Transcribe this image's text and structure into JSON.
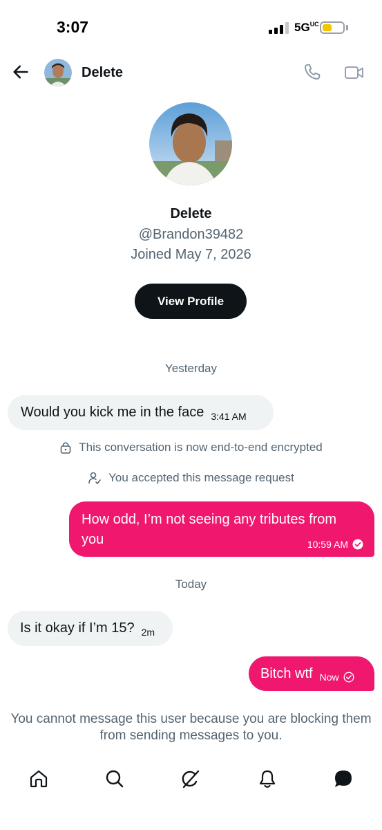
{
  "status_bar": {
    "time": "3:07",
    "network": "5G",
    "network_suffix": "UC",
    "battery_fill_fraction": 0.45,
    "battery_color": "#f5c400"
  },
  "header": {
    "title": "Delete"
  },
  "profile": {
    "name": "Delete",
    "handle": "@Brandon39482",
    "joined": "Joined May 7, 2026",
    "view_profile_label": "View Profile"
  },
  "conversation": {
    "date_yesterday": "Yesterday",
    "date_today": "Today",
    "messages": [
      {
        "direction": "incoming",
        "text": "Would you kick me in the face",
        "time": "3:41 AM"
      },
      {
        "direction": "outgoing",
        "text": "How odd, I’m not seeing any tributes from you",
        "time": "10:59 AM"
      },
      {
        "direction": "incoming",
        "text": "Is it okay if I’m 15?",
        "time": "2m"
      },
      {
        "direction": "outgoing",
        "text": "Bitch wtf",
        "time": "Now"
      }
    ],
    "system": {
      "encrypted": "This conversation is now end-to-end encrypted",
      "accepted": "You accepted this message request"
    },
    "blocked_notice": "You cannot message this user because you are blocking them from sending messages to you."
  },
  "colors": {
    "accent_pink": "#f0176f",
    "text_secondary": "#536471",
    "incoming_bubble": "#eff3f4",
    "primary_button": "#0f1419"
  },
  "bottom_nav": [
    "home-icon",
    "search-icon",
    "grok-icon",
    "notifications-icon",
    "messages-icon"
  ]
}
